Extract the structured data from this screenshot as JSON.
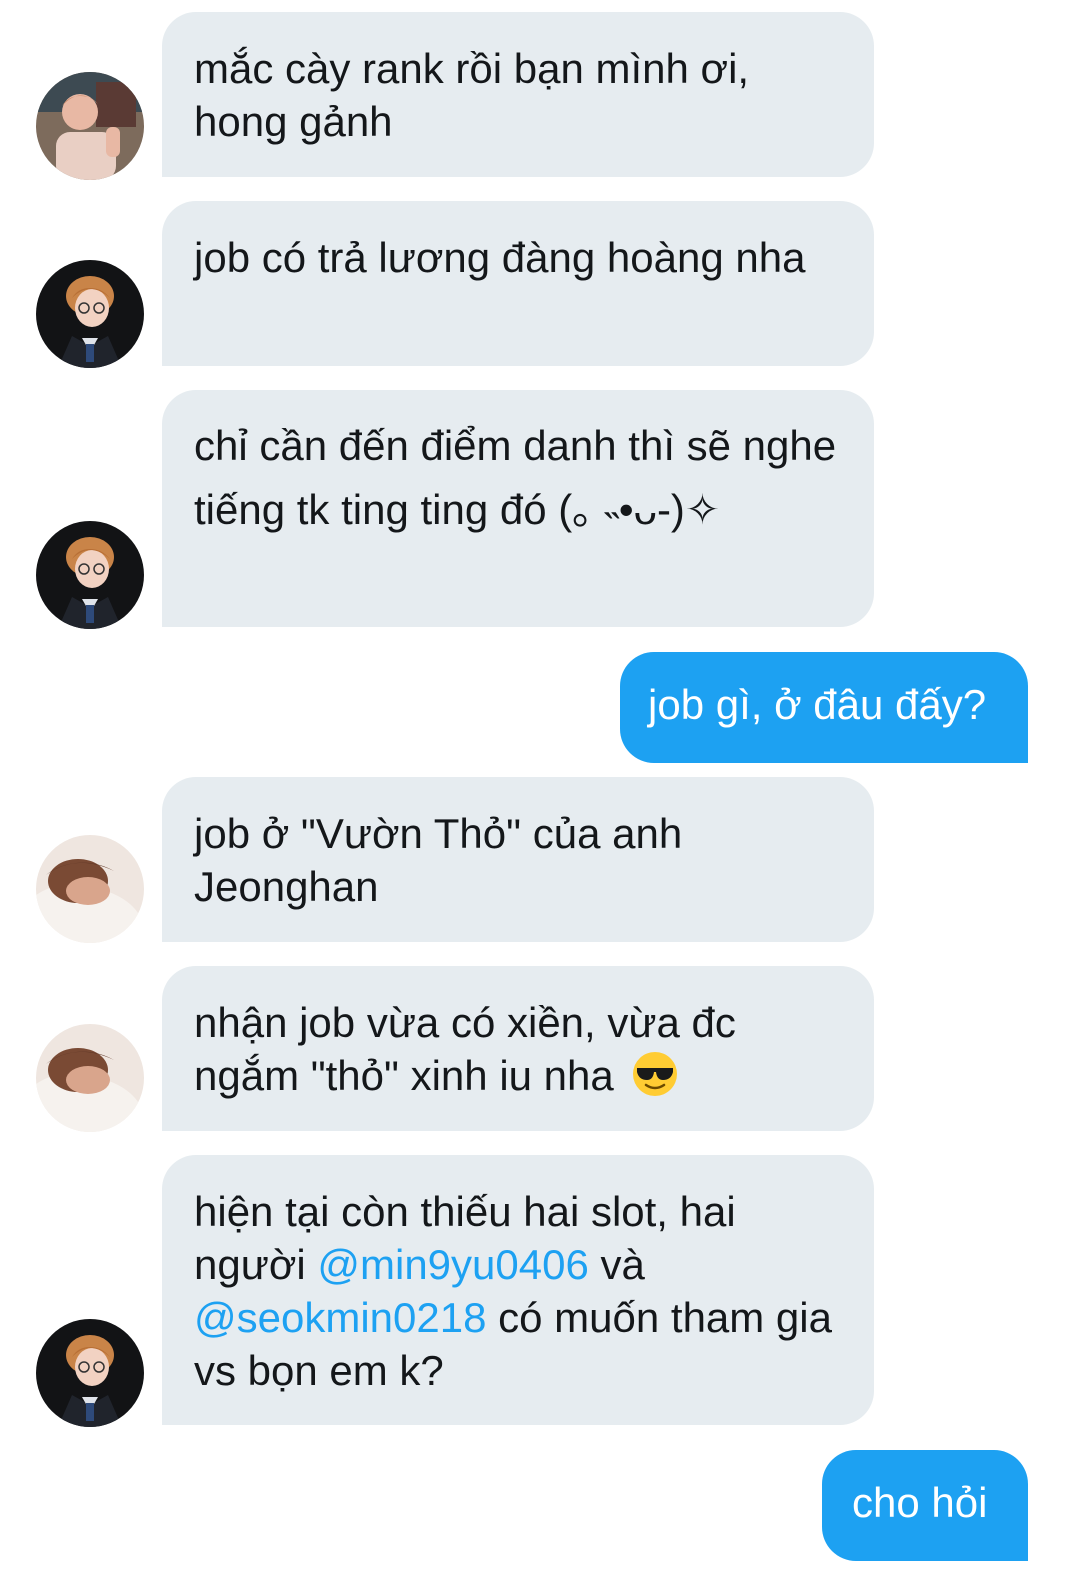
{
  "colors": {
    "incoming_bubble": "#e6ecf0",
    "outgoing_bubble": "#1da1f2",
    "mention": "#1da1f2",
    "text": "#14171a"
  },
  "messages": [
    {
      "side": "in",
      "avatar": "avatar-a",
      "text": "mắc cày rank rồi bạn mình ơi, hong gảnh"
    },
    {
      "side": "in",
      "avatar": "avatar-b",
      "text": "job có trả lương đàng hoàng nha"
    },
    {
      "side": "in",
      "avatar": "avatar-b",
      "text": "chỉ cần đến điểm danh thì sẽ nghe tiếng tk ting ting đó (｡ ˵•ᴗ-)✧"
    },
    {
      "side": "out",
      "text": "job gì, ở đâu đấy?"
    },
    {
      "side": "in",
      "avatar": "avatar-c",
      "text": "job ở \"Vườn Thỏ\" của anh Jeonghan"
    },
    {
      "side": "in",
      "avatar": "avatar-c",
      "text_before_emoji": "nhận job vừa có xiền, vừa đc ngắm \"thỏ\" xinh iu nha",
      "emoji": "sunglasses-emoji"
    },
    {
      "side": "in",
      "avatar": "avatar-b",
      "text_part1": "hiện tại còn thiếu hai slot, hai người ",
      "mention1": "@min9yu0406",
      "text_part2": " và ",
      "mention2": "@seokmin0218",
      "text_part3": " có muốn tham gia vs bọn em k?"
    },
    {
      "side": "out",
      "text": "cho hỏi"
    }
  ]
}
